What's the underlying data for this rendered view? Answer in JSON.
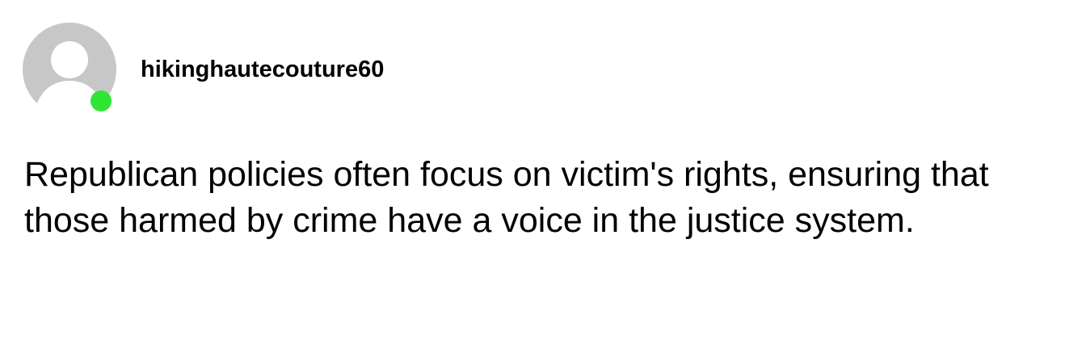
{
  "post": {
    "author": {
      "username": "hikinghautecouture60",
      "avatar_icon": "default-user-avatar-icon",
      "online": true,
      "online_color": "#2ee533",
      "avatar_color": "#c8c8c8"
    },
    "body": "Republican policies often focus on victim's rights, ensuring that those harmed by crime have a voice in the justice system."
  }
}
